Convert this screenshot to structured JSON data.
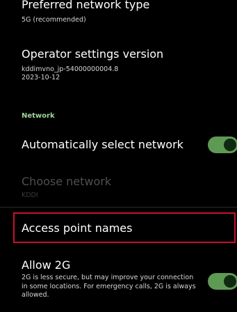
{
  "mobile_network_settings": {
    "preferred_network_type": {
      "title": "Preferred network type",
      "value": "5G (recommended)"
    },
    "operator_settings_version": {
      "title": "Operator settings version",
      "line1": "kddimvno_jp-54000000004.8",
      "line2": "2023-10-12"
    },
    "network_section": {
      "header": "Network",
      "auto_select": {
        "title": "Automatically select network",
        "toggle_on": true
      },
      "choose_network": {
        "title": "Choose network",
        "value": "KDDI",
        "enabled": false
      },
      "access_point_names": {
        "title": "Access point names"
      },
      "allow_2g": {
        "title": "Allow 2G",
        "description": "2G is less secure, but may improve your connection in some locations. For emergency calls, 2G is always allowed.",
        "toggle_on": true
      }
    }
  },
  "colors": {
    "background": "#000000",
    "toggle_track": "#5f9a55",
    "section_header": "#9fd59a",
    "highlight_border": "#c8102e"
  }
}
